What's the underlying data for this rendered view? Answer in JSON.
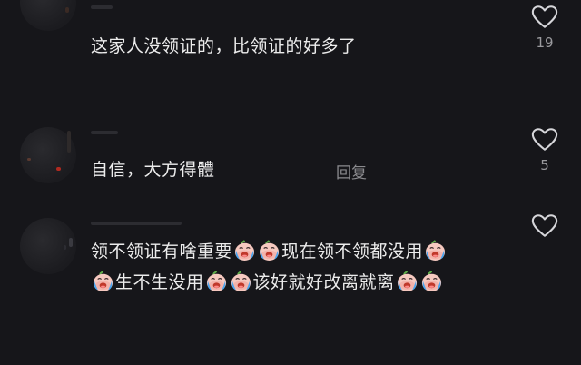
{
  "comments": [
    {
      "text": "这家人没领证的，比领证的好多了",
      "likes": "19",
      "like_icon": "heart-outline-icon"
    },
    {
      "text": "自信，大方得體",
      "reply_label": "回复",
      "likes": "5",
      "like_icon": "heart-outline-icon"
    },
    {
      "line1_a": "领不领证有啥重要",
      "line1_b": "现在领不领都没用",
      "line2_a": "生不生没用",
      "line2_b": "该好就好改离就离",
      "emoji_icon": "crying-face-sticker-icon",
      "like_icon": "heart-outline-icon"
    }
  ],
  "colors": {
    "background": "#16161a",
    "text": "#ececec",
    "secondary": "#9a9a9e",
    "emoji_face": "#f6c9c0",
    "emoji_tear": "#4aa6f0"
  }
}
